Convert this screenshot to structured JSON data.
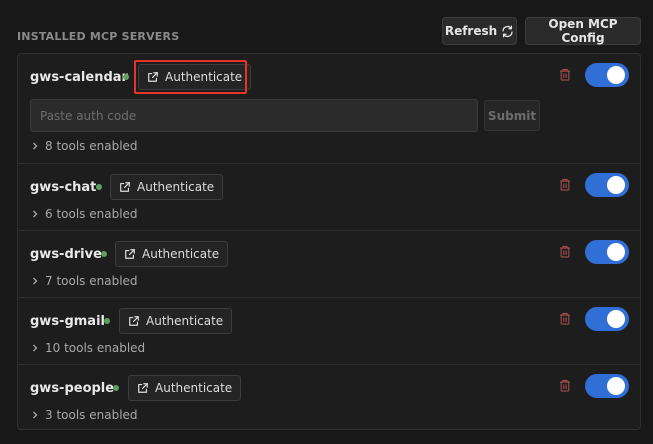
{
  "header": {
    "title": "INSTALLED MCP SERVERS",
    "refresh_label": "Refresh",
    "open_config_label": "Open MCP Config"
  },
  "servers": [
    {
      "name": "gws-calendar",
      "status": "connected",
      "auth_label": "Authenticate",
      "tools_label": "8 tools enabled",
      "enabled": true,
      "auth_input_placeholder": "Paste auth code",
      "submit_label": "Submit"
    },
    {
      "name": "gws-chat",
      "status": "connected",
      "auth_label": "Authenticate",
      "tools_label": "6 tools enabled",
      "enabled": true
    },
    {
      "name": "gws-drive",
      "status": "connected",
      "auth_label": "Authenticate",
      "tools_label": "7 tools enabled",
      "enabled": true
    },
    {
      "name": "gws-gmail",
      "status": "connected",
      "auth_label": "Authenticate",
      "tools_label": "10 tools enabled",
      "enabled": true
    },
    {
      "name": "gws-people",
      "status": "connected",
      "auth_label": "Authenticate",
      "tools_label": "3 tools enabled",
      "enabled": true
    }
  ],
  "colors": {
    "status_connected": "#5fa05f",
    "toggle_on": "#2f6fd6",
    "highlight": "#e8332a",
    "trash": "#9a4a4a"
  },
  "icons": {
    "refresh": "refresh-icon",
    "external_link": "external-link-icon",
    "trash": "trash-icon",
    "chevron": "chevron-right-icon"
  }
}
